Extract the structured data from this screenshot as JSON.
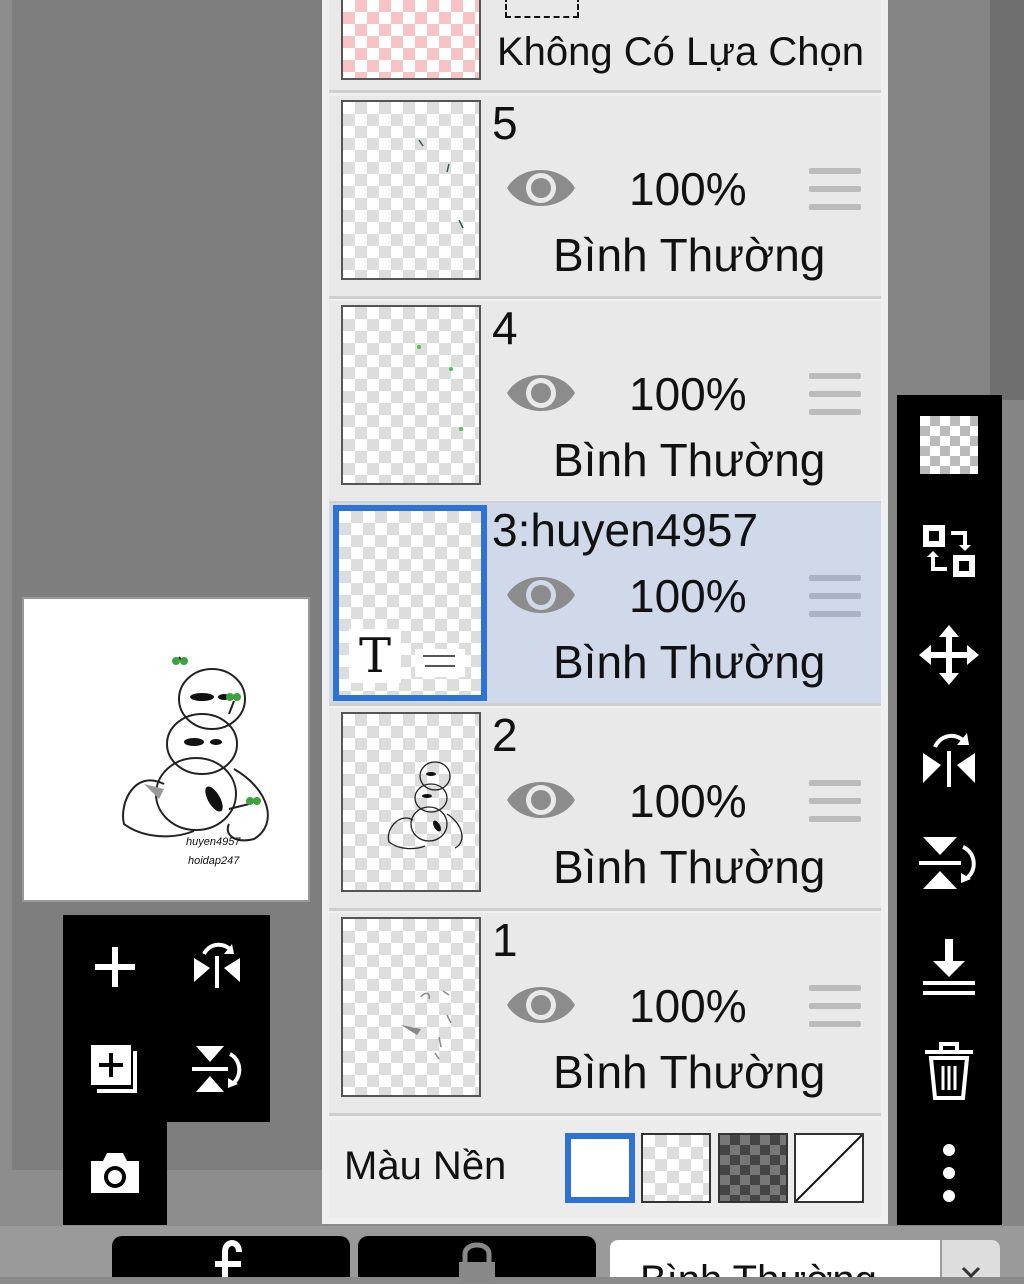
{
  "selection_layer": {
    "label": "Không Có Lựa Chọn"
  },
  "layers": [
    {
      "name": "5",
      "opacity": "100%",
      "blend": "Bình Thường",
      "selected": false
    },
    {
      "name": "4",
      "opacity": "100%",
      "blend": "Bình Thường",
      "selected": false
    },
    {
      "name": "3:huyen4957",
      "opacity": "100%",
      "blend": "Bình Thường",
      "selected": true,
      "text_marker": "T"
    },
    {
      "name": "2",
      "opacity": "100%",
      "blend": "Bình Thường",
      "selected": false
    },
    {
      "name": "1",
      "opacity": "100%",
      "blend": "Bình Thường",
      "selected": false
    }
  ],
  "background_color": {
    "label": "Màu Nền",
    "options": [
      "white",
      "transparent",
      "dark-checker",
      "none"
    ],
    "selected": "white"
  },
  "preview": {
    "line1": "huyen4957",
    "line2": "hoidap247"
  },
  "bottom_bar": {
    "blend_partial": "Bình Thường"
  },
  "colors": {
    "selection_border": "#2f72d6",
    "selected_row": "#cfd9ea",
    "toolbar": "#000000"
  }
}
